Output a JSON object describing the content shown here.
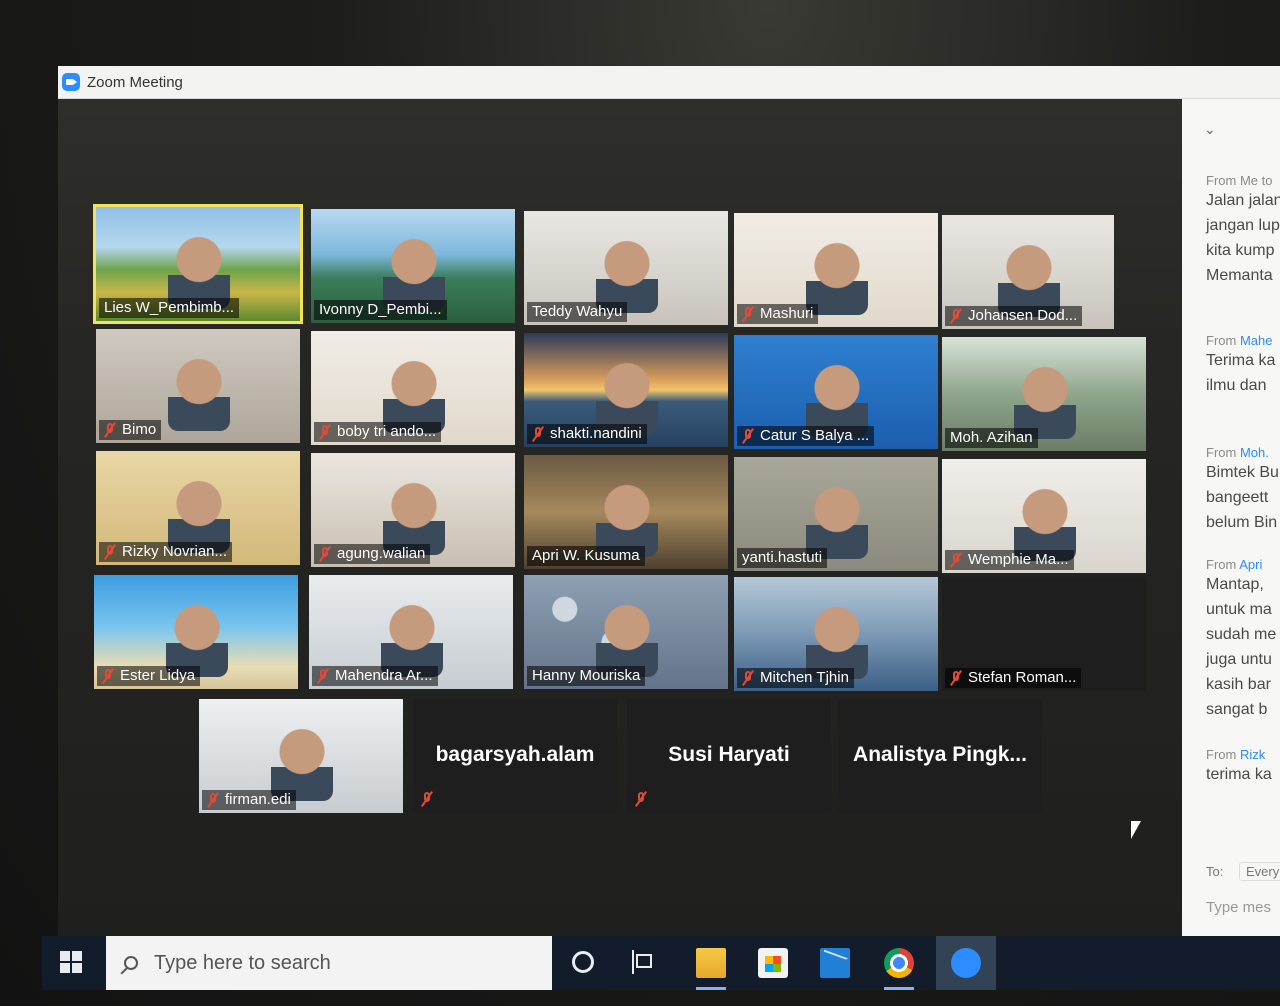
{
  "window": {
    "title": "Zoom Meeting"
  },
  "participants": [
    {
      "name": "Lies W_Pembimb...",
      "muted": false,
      "active": true
    },
    {
      "name": "Ivonny D_Pembi...",
      "muted": false
    },
    {
      "name": "Teddy Wahyu",
      "muted": false
    },
    {
      "name": "Mashuri",
      "muted": true
    },
    {
      "name": "Johansen Dod...",
      "muted": true
    },
    {
      "name": "Bimo",
      "muted": true
    },
    {
      "name": "boby tri ando...",
      "muted": true
    },
    {
      "name": "shakti.nandini",
      "muted": true
    },
    {
      "name": "Catur S Balya ...",
      "muted": true
    },
    {
      "name": "Moh. Azihan",
      "muted": false
    },
    {
      "name": "Rizky Novrian...",
      "muted": true
    },
    {
      "name": "agung.walian",
      "muted": true
    },
    {
      "name": "Apri W. Kusuma",
      "muted": false
    },
    {
      "name": "yanti.hastuti",
      "muted": false
    },
    {
      "name": "Wemphie Ma...",
      "muted": true
    },
    {
      "name": "Ester Lidya",
      "muted": true
    },
    {
      "name": "Mahendra Ar...",
      "muted": true
    },
    {
      "name": "Hanny Mouriska",
      "muted": false
    },
    {
      "name": "Mitchen Tjhin",
      "muted": true
    },
    {
      "name": "Stefan Roman...",
      "muted": true
    },
    {
      "name": "firman.edi",
      "muted": true
    },
    {
      "name": "bagarsyah.alam",
      "muted": true,
      "video": false
    },
    {
      "name": "Susi Haryati",
      "muted": true,
      "video": false
    },
    {
      "name": "Analistya  Pingk...",
      "muted": false,
      "video": false
    }
  ],
  "chat": {
    "messages": [
      {
        "from_prefix": "From Me to",
        "from_name": "",
        "lines": [
          "Jalan jalan",
          "jangan lup",
          "kita kump",
          "Memanta"
        ]
      },
      {
        "from_prefix": "From",
        "from_name": "Mahe",
        "lines": [
          "Terima ka",
          "ilmu dan"
        ]
      },
      {
        "from_prefix": "From",
        "from_name": "Moh.",
        "lines": [
          "Bimtek Bu",
          "bangeett",
          "belum Bin"
        ]
      },
      {
        "from_prefix": "From",
        "from_name": "Apri",
        "lines": [
          "Mantap,",
          "untuk ma",
          "sudah me",
          "juga untu",
          "kasih bar",
          "sangat b"
        ]
      },
      {
        "from_prefix": "From",
        "from_name": "Rizk",
        "lines": [
          "terima ka"
        ]
      }
    ],
    "to_label": "To:",
    "to_value": "Every",
    "input_placeholder": "Type mes"
  },
  "taskbar": {
    "search_placeholder": "Type here to search",
    "apps": [
      "cortana-icon",
      "task-view-icon",
      "file-explorer-icon",
      "store-icon",
      "mail-icon",
      "chrome-icon",
      "zoom-icon"
    ]
  }
}
